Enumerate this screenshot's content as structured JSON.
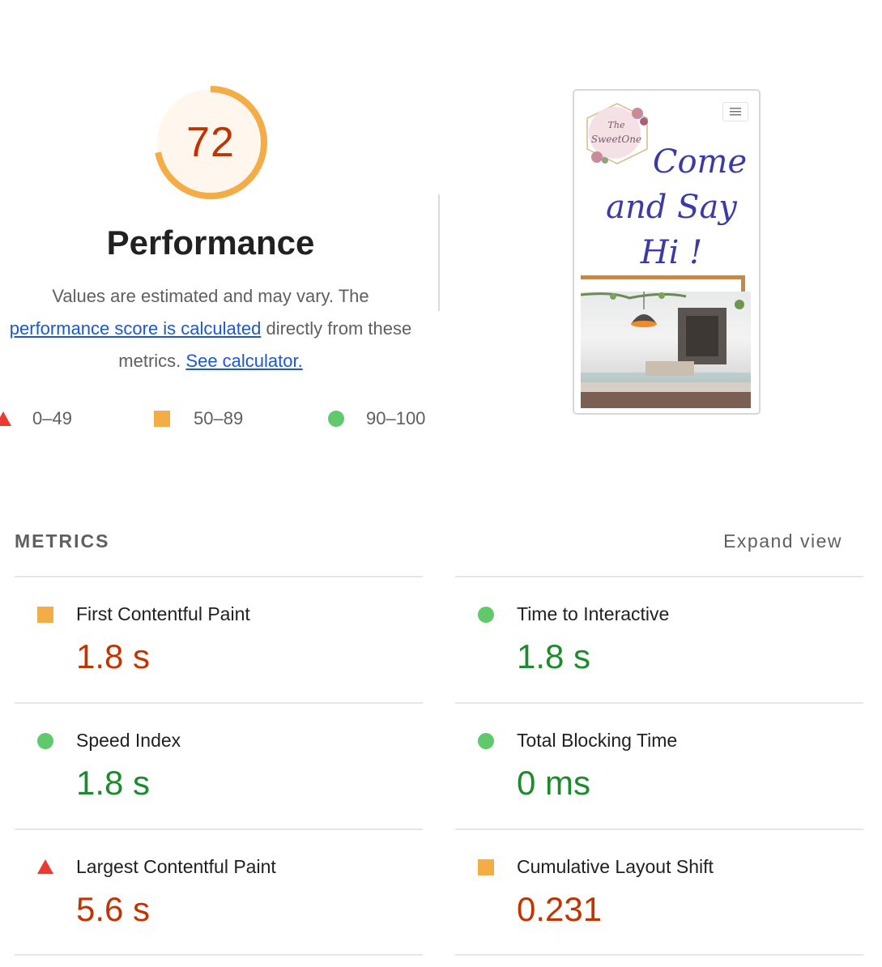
{
  "performance": {
    "score": "72",
    "score_fraction": 0.72,
    "title": "Performance",
    "desc_prefix": "Values are estimated and may vary. The",
    "desc_link": "performance score is calculated",
    "desc_middle": "directly from these metrics.",
    "calculator_link": "See calculator.",
    "colors": {
      "average": "#f4ad46",
      "fail": "#eb3a32",
      "pass": "#60c96b",
      "score_text": "#c33300"
    }
  },
  "legend": [
    {
      "shape": "triangle-icon",
      "label": "0–49"
    },
    {
      "shape": "square-icon",
      "label": "50–89"
    },
    {
      "shape": "circle-icon",
      "label": "90–100"
    }
  ],
  "preview": {
    "heading_line1": "Come",
    "heading_line2": "and Say",
    "heading_line3": "Hi !",
    "logo_text": "The SweetOne"
  },
  "metrics": {
    "label": "METRICS",
    "expand": "Expand view",
    "items": [
      {
        "name": "First Contentful Paint",
        "value": "1.8 s",
        "rating": "average"
      },
      {
        "name": "Time to Interactive",
        "value": "1.8 s",
        "rating": "pass"
      },
      {
        "name": "Speed Index",
        "value": "1.8 s",
        "rating": "pass"
      },
      {
        "name": "Total Blocking Time",
        "value": "0 ms",
        "rating": "pass"
      },
      {
        "name": "Largest Contentful Paint",
        "value": "5.6 s",
        "rating": "fail"
      },
      {
        "name": "Cumulative Layout Shift",
        "value": "0.231",
        "rating": "average"
      }
    ]
  }
}
